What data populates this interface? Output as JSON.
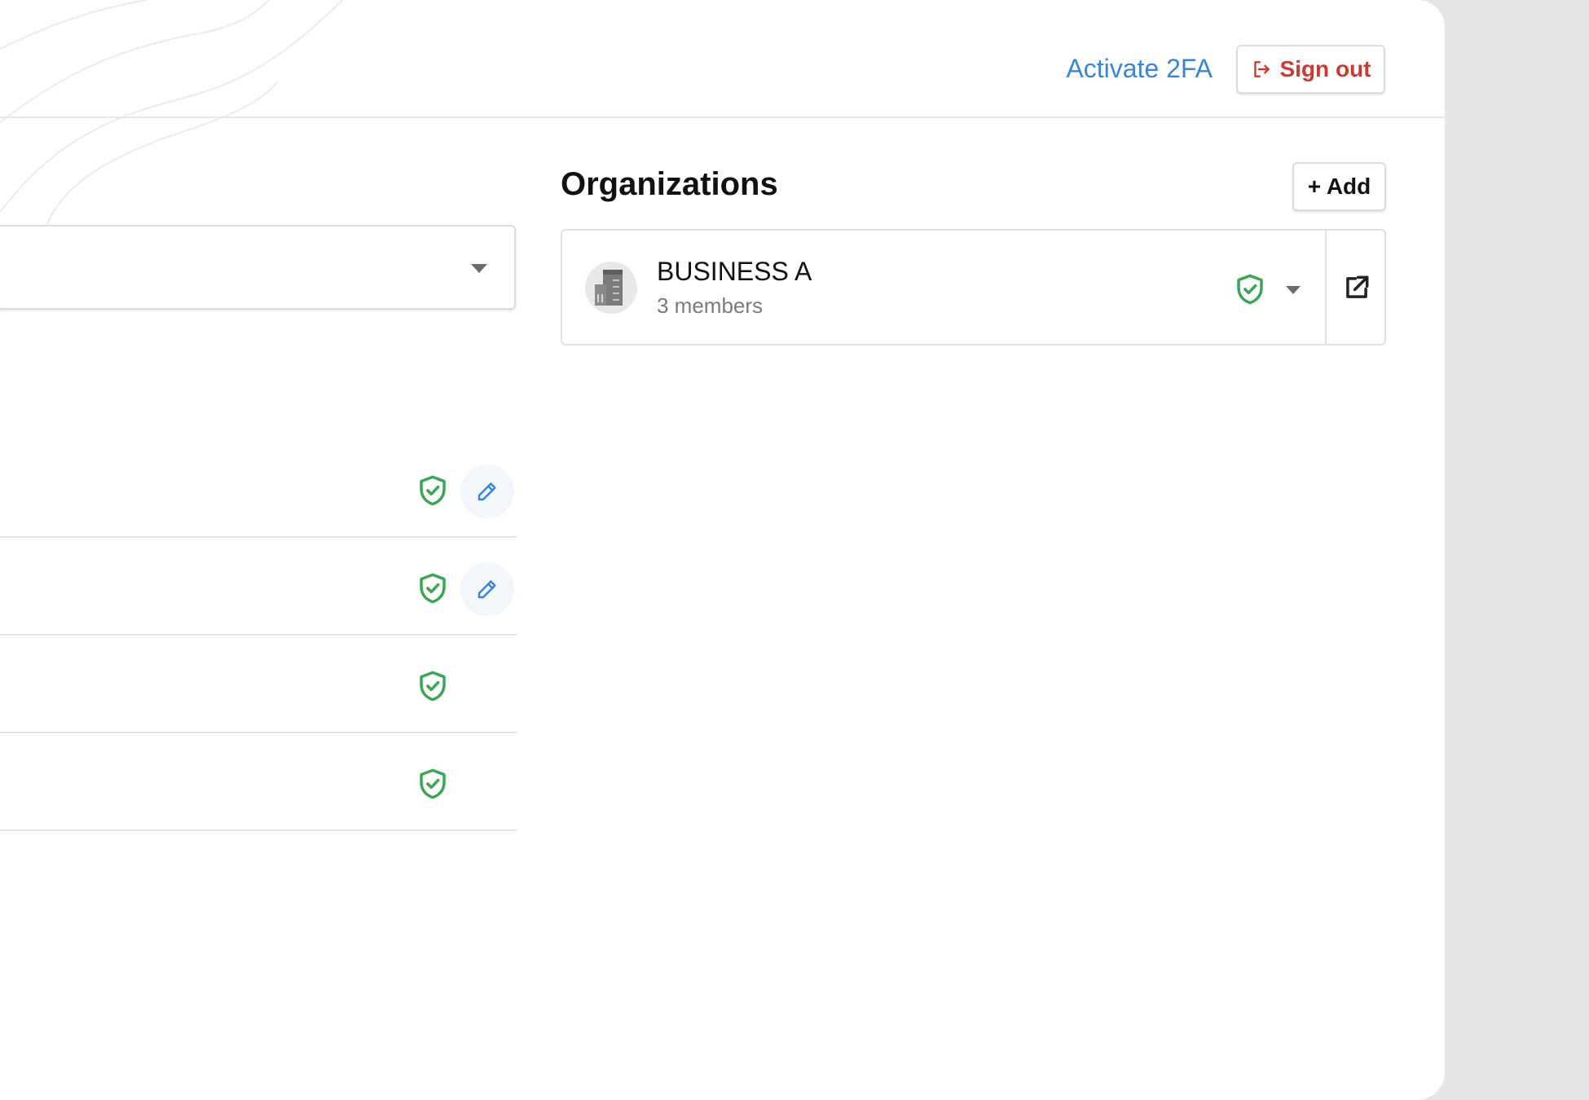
{
  "header": {
    "activate_2fa_label": "Activate 2FA",
    "sign_out_label": "Sign out"
  },
  "colors": {
    "link_blue": "#3b85d6",
    "danger_red": "#cc3a33",
    "shield_green": "#3aa655",
    "panel_bg": "#ffffff",
    "page_bg": "#e6e6e6"
  },
  "icons": {
    "sign_out": "sign-out-icon",
    "shield": "shield-check-icon",
    "edit": "pencil-icon",
    "open": "external-link-icon",
    "avatar": "building-icon",
    "dropdown": "caret-down-icon"
  },
  "list": {
    "rows": [
      {
        "verified": true,
        "editable": true
      },
      {
        "verified": true,
        "editable": true
      },
      {
        "verified": true,
        "editable": false
      },
      {
        "verified": true,
        "editable": false
      }
    ]
  },
  "organizations": {
    "title": "Organizations",
    "add_label": "+ Add",
    "items": [
      {
        "name": "BUSINESS A",
        "members": "3 members",
        "verified": true
      }
    ]
  }
}
